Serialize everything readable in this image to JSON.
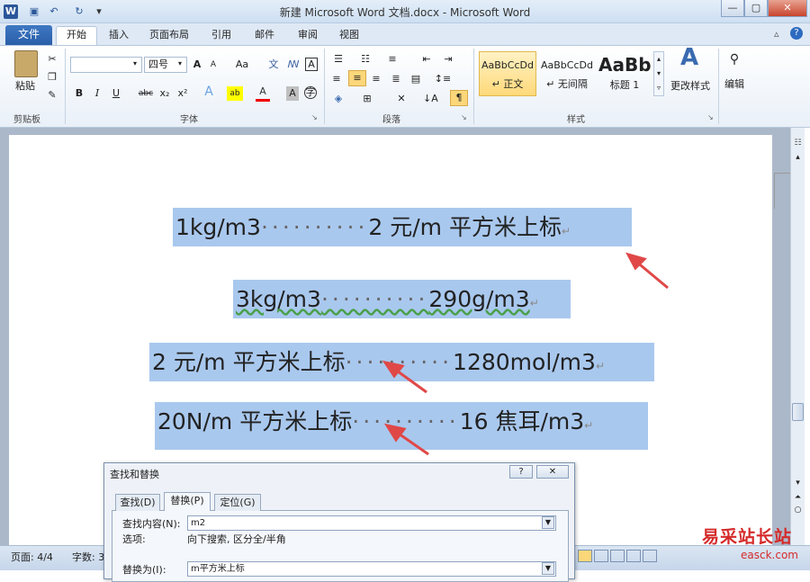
{
  "window": {
    "title": "新建 Microsoft Word 文档.docx - Microsoft Word",
    "app_icon": "W"
  },
  "tabs": {
    "file": "文件",
    "items": [
      "开始",
      "插入",
      "页面布局",
      "引用",
      "邮件",
      "审阅",
      "视图"
    ]
  },
  "ribbon": {
    "clipboard": {
      "label": "剪贴板",
      "paste": "粘贴"
    },
    "font": {
      "label": "字体",
      "font_name": "",
      "font_size": "四号",
      "aa": "Aa"
    },
    "paragraph": {
      "label": "段落"
    },
    "styles": {
      "label": "样式",
      "items": [
        {
          "preview": "AaBbCcDd",
          "name": "↵ 正文"
        },
        {
          "preview": "AaBbCcDd",
          "name": "↵ 无间隔"
        },
        {
          "preview": "AaBb",
          "name": "标题 1"
        }
      ],
      "change": "更改样式"
    },
    "editing": {
      "label": "编辑"
    }
  },
  "document": {
    "lines": [
      {
        "left": "1kg/m3",
        "right": "2 元/m 平方米上标"
      },
      {
        "left": "3kg/m3",
        "right": "290g/m3"
      },
      {
        "left": "2 元/m 平方米上标",
        "right": "1280mol/m3"
      },
      {
        "left": "20N/m 平方米上标",
        "right": "16 焦耳/m3"
      }
    ],
    "dots": "··········",
    "para_mark": "↵"
  },
  "dialog": {
    "title": "查找和替换",
    "help": "?",
    "tabs": [
      "查找(D)",
      "替换(P)",
      "定位(G)"
    ],
    "find_label": "查找内容(N):",
    "find_value": "m2",
    "options_label": "选项:",
    "options_value": "向下搜索, 区分全/半角",
    "replace_label": "替换为(I):",
    "replace_value": "m平方米上标"
  },
  "statusbar": {
    "page": "页面: 4/4",
    "words": "字数: 30"
  },
  "watermark": {
    "text": "易采站长站",
    "url": "easck.com"
  },
  "colors": {
    "highlight": "#a9c8ee",
    "arrow": "#e04848",
    "file_tab": "#2a5ea8"
  }
}
